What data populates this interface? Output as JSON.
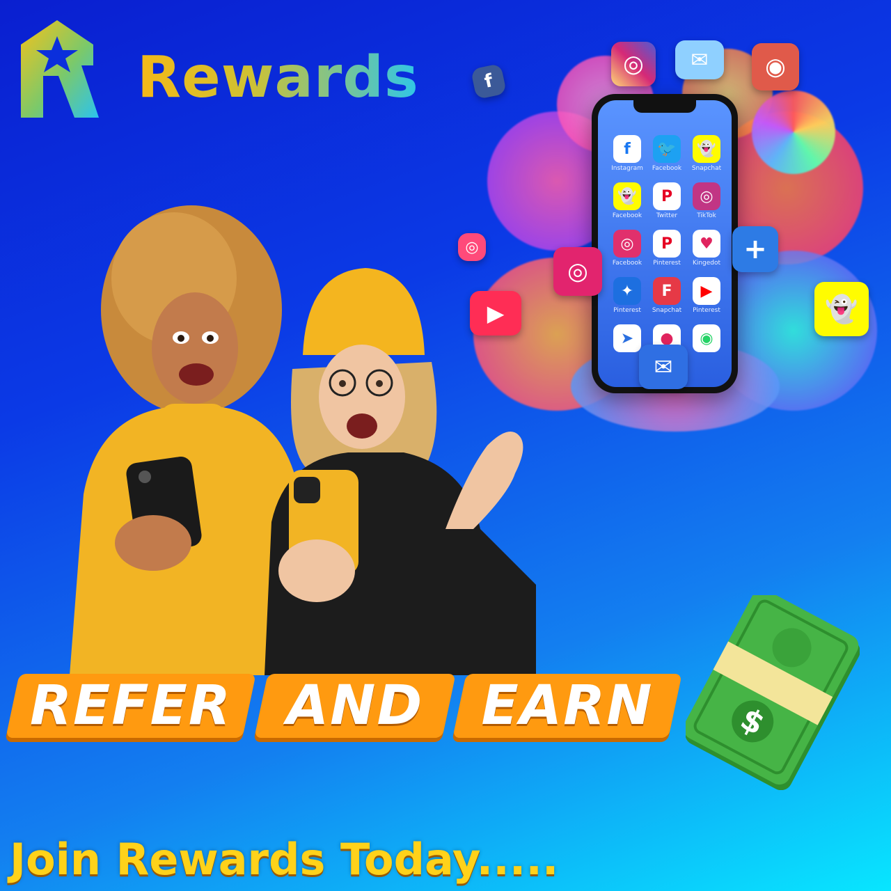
{
  "brand": {
    "name": "Rewards",
    "logo_icon": "star-badge-icon"
  },
  "banner": {
    "words": [
      "REFER",
      "AND",
      "EARN"
    ]
  },
  "tagline": "Join Rewards Today.....",
  "phone": {
    "apps": [
      {
        "label": "Instagram",
        "icon": "facebook-icon",
        "glyph": "f",
        "color": "#ffffff",
        "fg": "#1877f2"
      },
      {
        "label": "Facebook",
        "icon": "twitter-icon",
        "glyph": "🐦",
        "color": "#1da1f2",
        "fg": "#ffffff"
      },
      {
        "label": "Snapchat",
        "icon": "snapchat-icon",
        "glyph": "👻",
        "color": "#fffc00",
        "fg": "#333"
      },
      {
        "label": "Facebook",
        "icon": "snapchat-icon",
        "glyph": "👻",
        "color": "#fffc00",
        "fg": "#333"
      },
      {
        "label": "Twitter",
        "icon": "pinterest-icon",
        "glyph": "P",
        "color": "#ffffff",
        "fg": "#e60023"
      },
      {
        "label": "TikTok",
        "icon": "instagram-icon",
        "glyph": "◎",
        "color": "#c13584",
        "fg": "#ffffff"
      },
      {
        "label": "Facebook",
        "icon": "instagram-icon",
        "glyph": "◎",
        "color": "#e1306c",
        "fg": "#ffffff"
      },
      {
        "label": "Pinterest",
        "icon": "pinterest-icon",
        "glyph": "P",
        "color": "#ffffff",
        "fg": "#e60023"
      },
      {
        "label": "Kingedot",
        "icon": "heart-icon",
        "glyph": "♥",
        "color": "#ffffff",
        "fg": "#e0245e"
      },
      {
        "label": "Pinterest",
        "icon": "bluebird-icon",
        "glyph": "✦",
        "color": "#1d6fe0",
        "fg": "#ffffff"
      },
      {
        "label": "Snapchat",
        "icon": "flipboard-icon",
        "glyph": "F",
        "color": "#e63946",
        "fg": "#ffffff"
      },
      {
        "label": "Pinterest",
        "icon": "youtube-icon",
        "glyph": "▶",
        "color": "#ffffff",
        "fg": "#ff0000"
      },
      {
        "label": "",
        "icon": "send-icon",
        "glyph": "➤",
        "color": "#ffffff",
        "fg": "#2a6fe0"
      },
      {
        "label": "",
        "icon": "location-icon",
        "glyph": "●",
        "color": "#ffffff",
        "fg": "#e0245e"
      },
      {
        "label": "",
        "icon": "whatsapp-icon",
        "glyph": "◉",
        "color": "#ffffff",
        "fg": "#25d366"
      }
    ]
  },
  "money_icon": "dollar-bill-icon",
  "colors": {
    "accent_orange": "#ff9a10",
    "tagline_yellow": "#ffd21a",
    "money_green": "#3cb043"
  }
}
